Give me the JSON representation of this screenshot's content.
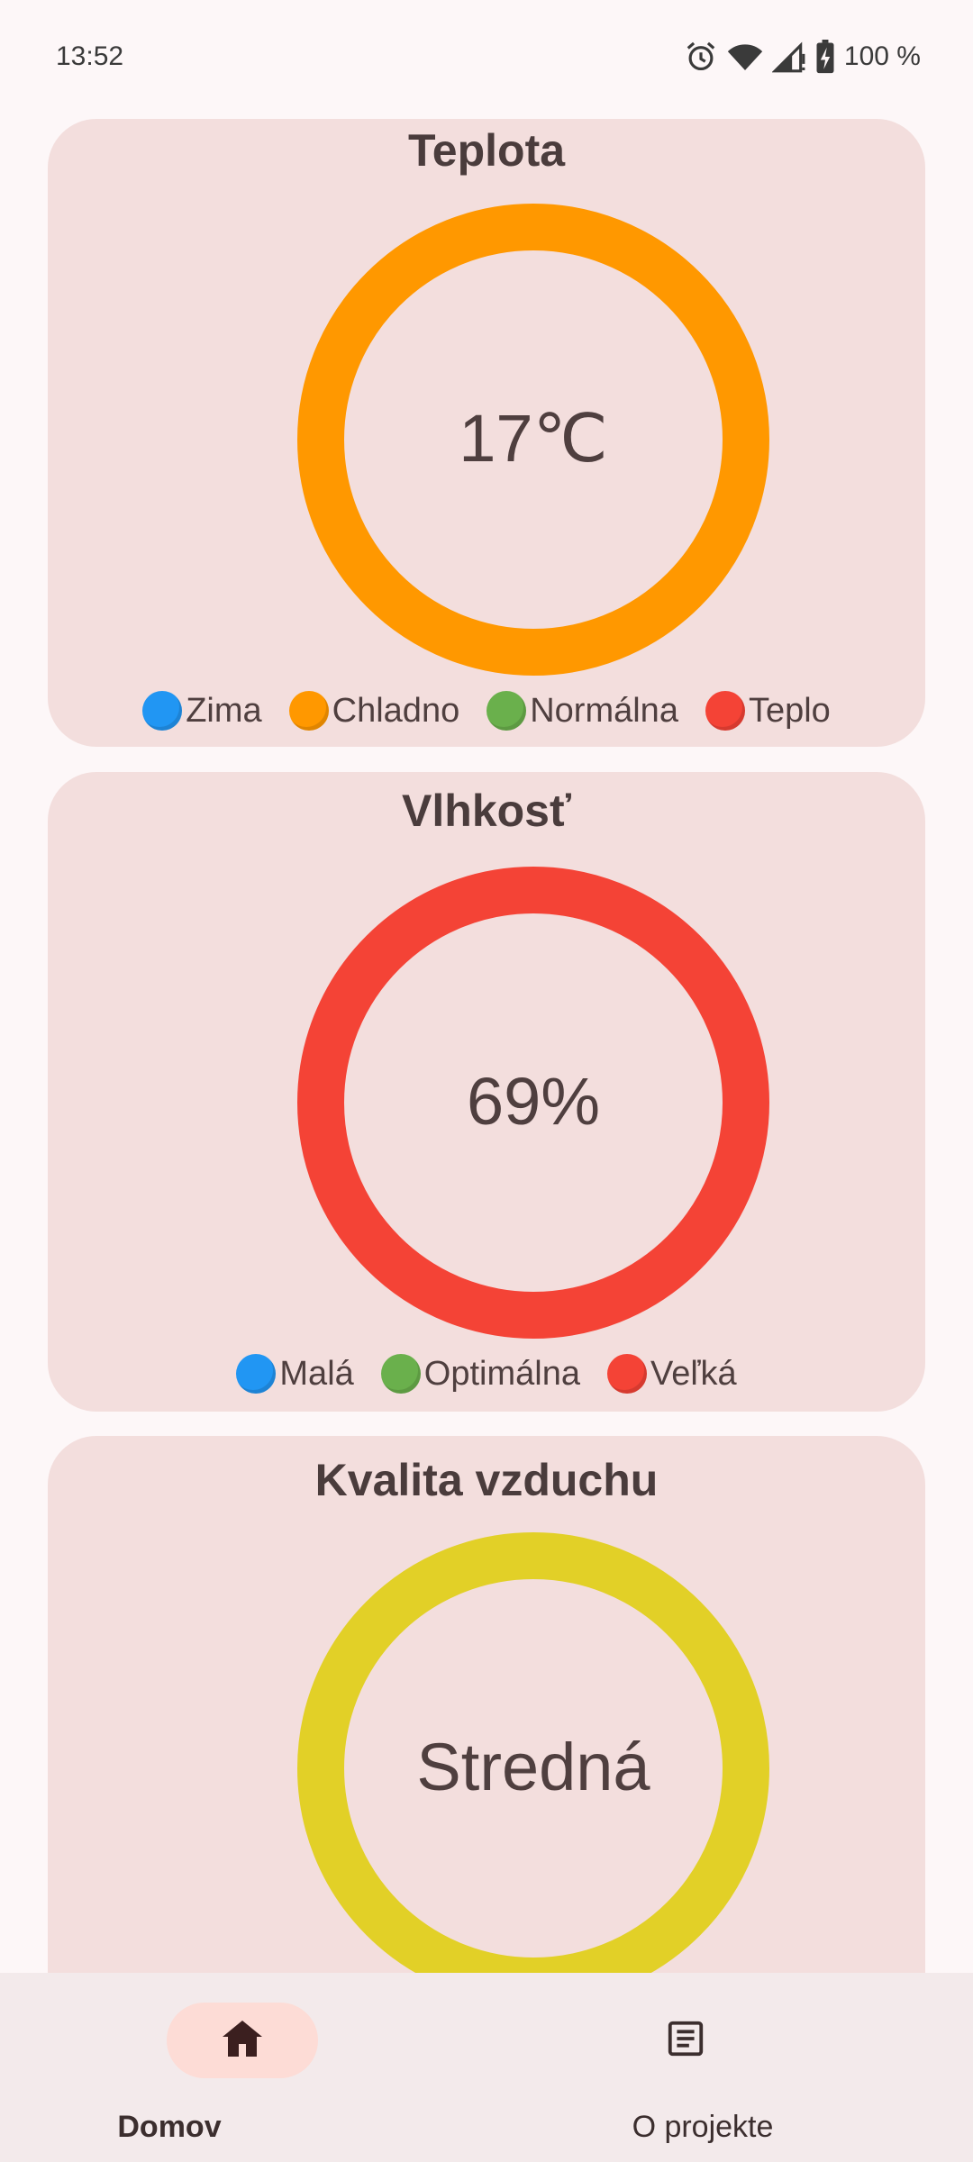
{
  "status_bar": {
    "time": "13:52",
    "battery": "100 %",
    "icons": [
      "alarm-icon",
      "wifi-icon",
      "signal-icon",
      "battery-charging-icon"
    ]
  },
  "cards": [
    {
      "title": "Teplota",
      "value": "17℃",
      "ring_color": "#ff9800",
      "legend": [
        {
          "label": "Zima",
          "color": "#2196f3"
        },
        {
          "label": "Chladno",
          "color": "#ff9800"
        },
        {
          "label": "Normálna",
          "color": "#6ab04c"
        },
        {
          "label": "Teplo",
          "color": "#f44336"
        }
      ]
    },
    {
      "title": "Vlhkosť",
      "value": "69%",
      "ring_color": "#f44336",
      "legend": [
        {
          "label": "Malá",
          "color": "#2196f3"
        },
        {
          "label": "Optimálna",
          "color": "#6ab04c"
        },
        {
          "label": "Veľká",
          "color": "#f44336"
        }
      ]
    },
    {
      "title": "Kvalita vzduchu",
      "value": "Stredná",
      "ring_color": "#e2d027"
    }
  ],
  "nav": {
    "items": [
      {
        "label": "Domov",
        "icon": "home-icon",
        "active": true,
        "pill_color": "#fddcd6"
      },
      {
        "label": "O projekte",
        "icon": "article-icon",
        "active": false
      }
    ]
  }
}
